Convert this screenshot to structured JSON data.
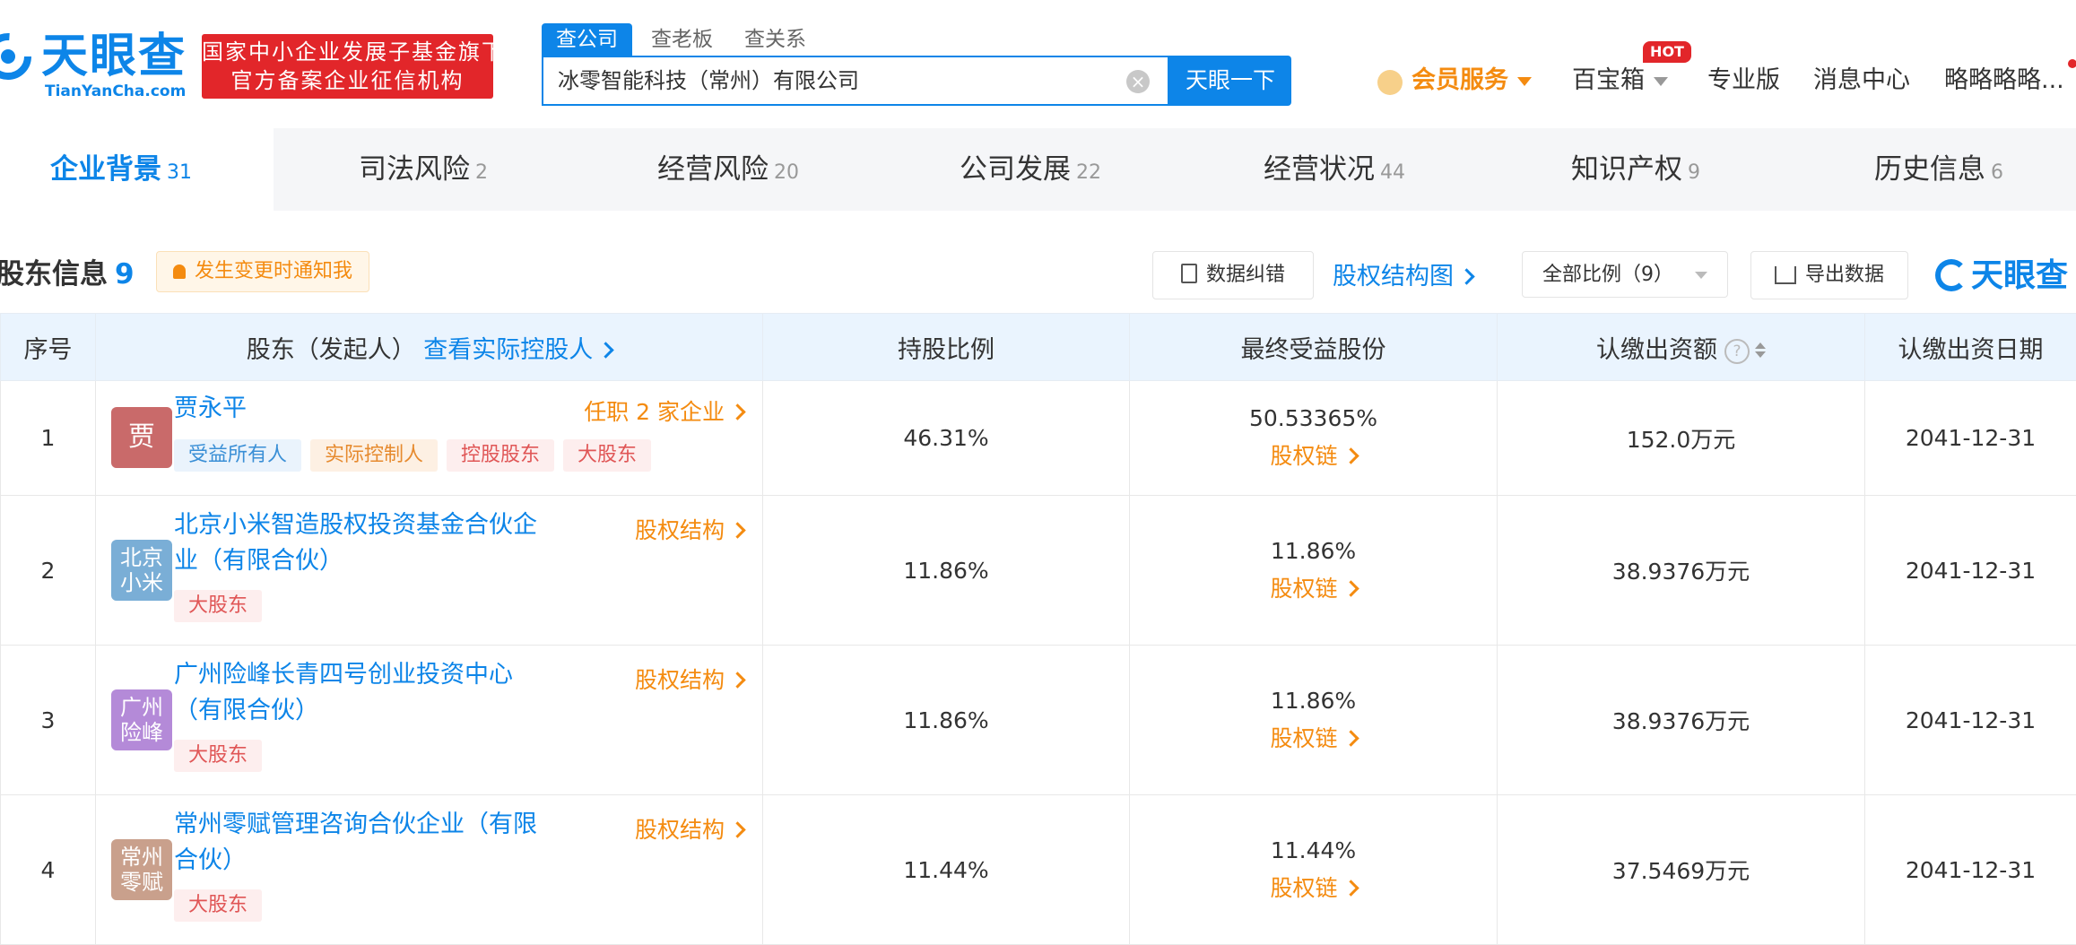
{
  "header": {
    "logo_text": "天眼查",
    "logo_sub": "TianYanCha.com",
    "banner_line1": "国家中小企业发展子基金旗下",
    "banner_line2": "官方备案企业征信机构",
    "search_tabs": [
      "查公司",
      "查老板",
      "查关系"
    ],
    "search_value": "冰零智能科技（常州）有限公司",
    "search_button": "天眼一下",
    "vip_label": "会员服务",
    "nav": [
      "百宝箱",
      "专业版",
      "消息中心",
      "略略略略..."
    ],
    "hot_badge": "HOT"
  },
  "categories": [
    {
      "label": "企业背景",
      "count": "31"
    },
    {
      "label": "司法风险",
      "count": "2"
    },
    {
      "label": "经营风险",
      "count": "20"
    },
    {
      "label": "公司发展",
      "count": "22"
    },
    {
      "label": "经营状况",
      "count": "44"
    },
    {
      "label": "知识产权",
      "count": "9"
    },
    {
      "label": "历史信息",
      "count": "6"
    }
  ],
  "section": {
    "title": "股东信息",
    "count": "9",
    "notify": "发生变更时通知我",
    "correct_btn": "数据纠错",
    "structure_link": "股权结构图",
    "ratio_select": "全部比例（9）",
    "export_btn": "导出数据",
    "watermark": "天眼查"
  },
  "table": {
    "headers": {
      "seq": "序号",
      "holder": "股东（发起人）",
      "holder_link": "查看实际控股人",
      "ratio": "持股比例",
      "final": "最终受益股份",
      "capital": "认缴出资额",
      "date": "认缴出资日期"
    },
    "rows": [
      {
        "seq": "1",
        "avatar": "贾",
        "avatar_color": "#c96a6a",
        "name": "贾永平",
        "link": "任职 2 家企业",
        "tags": [
          "受益所有人",
          "实际控制人",
          "控股股东",
          "大股东"
        ],
        "ratio": "46.31%",
        "final": "50.53365%",
        "chain": "股权链",
        "capital": "152.0万元",
        "date": "2041-12-31"
      },
      {
        "seq": "2",
        "avatar": "北京小米",
        "avatar_color": "#7aaed6",
        "name": "北京小米智造股权投资基金合伙企业（有限合伙）",
        "link": "股权结构",
        "tags": [
          "大股东"
        ],
        "ratio": "11.86%",
        "final": "11.86%",
        "chain": "股权链",
        "capital": "38.9376万元",
        "date": "2041-12-31"
      },
      {
        "seq": "3",
        "avatar": "广州险峰",
        "avatar_color": "#b48ad8",
        "name": "广州险峰长青四号创业投资中心（有限合伙）",
        "link": "股权结构",
        "tags": [
          "大股东"
        ],
        "ratio": "11.86%",
        "final": "11.86%",
        "chain": "股权链",
        "capital": "38.9376万元",
        "date": "2041-12-31"
      },
      {
        "seq": "4",
        "avatar": "常州零赋",
        "avatar_color": "#c9a08c",
        "name": "常州零赋管理咨询合伙企业（有限合伙）",
        "link": "股权结构",
        "tags": [
          "大股东"
        ],
        "ratio": "11.44%",
        "final": "11.44%",
        "chain": "股权链",
        "capital": "37.5469万元",
        "date": "2041-12-31"
      }
    ]
  }
}
